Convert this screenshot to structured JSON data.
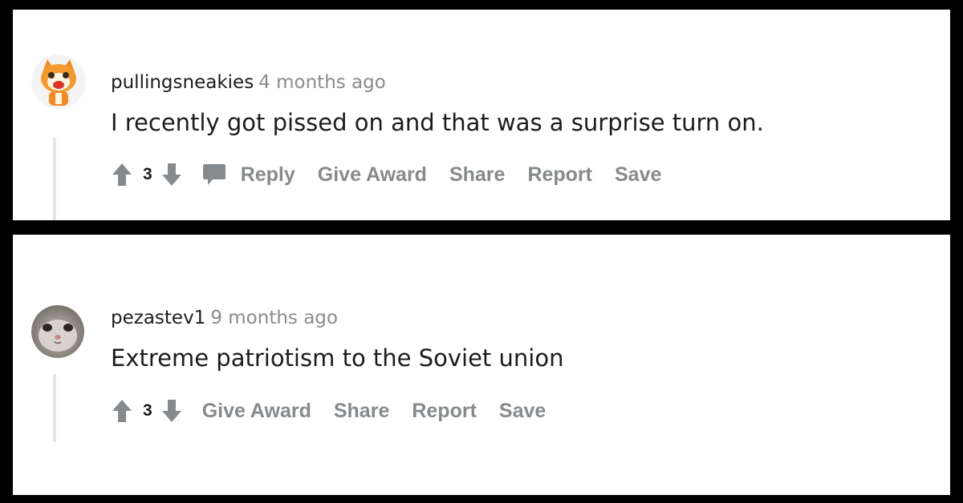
{
  "comments": [
    {
      "username": "pullingsneakies",
      "age": "4 months ago",
      "text": "I recently got pissed on and that was a surprise turn on.",
      "score": "3",
      "actions": {
        "reply": "Reply",
        "give_award": "Give Award",
        "share": "Share",
        "report": "Report",
        "save": "Save"
      },
      "avatar_icon": "orange-cartoon-fox-avatar"
    },
    {
      "username": "pezastev1",
      "age": "9 months ago",
      "text": "Extreme patriotism to the Soviet union",
      "score": "3",
      "actions": {
        "give_award": "Give Award",
        "share": "Share",
        "report": "Report",
        "save": "Save"
      },
      "avatar_icon": "cat-face-avatar"
    }
  ],
  "colors": {
    "background": "#000000",
    "panel": "#ffffff",
    "text": "#1c1c1c",
    "muted": "#878a8c",
    "thread_line": "#e6e6e6"
  },
  "icons": [
    "upvote-arrow-icon",
    "downvote-arrow-icon",
    "comment-bubble-icon"
  ]
}
